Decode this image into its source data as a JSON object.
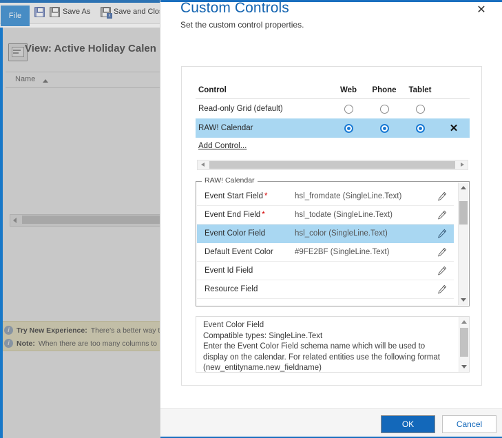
{
  "background_app": {
    "file_tab": "File",
    "ribbon_buttons": [
      {
        "label": "",
        "icon": "save-icon"
      },
      {
        "label": "Save As",
        "icon": "save-as-icon"
      },
      {
        "label": "Save and Clos",
        "icon": "save-and-close-icon"
      }
    ],
    "view_title": "View: Active Holiday Calen",
    "grid_column_header": "Name",
    "sort_direction": "ascending",
    "notices": [
      {
        "title": "Try New Experience:",
        "text": "There's a better way t"
      },
      {
        "title": "Note:",
        "text": "When there are too many columns to"
      }
    ]
  },
  "dialog": {
    "title": "Custom Controls",
    "subtitle": "Set the custom control properties.",
    "close_label": "✕",
    "controls_table": {
      "headers": [
        "Control",
        "Web",
        "Phone",
        "Tablet"
      ],
      "rows": [
        {
          "name": "Read-only Grid (default)",
          "web": false,
          "phone": false,
          "tablet": false,
          "selected": false,
          "deletable": false
        },
        {
          "name": "RAW! Calendar",
          "web": true,
          "phone": true,
          "tablet": true,
          "selected": true,
          "deletable": true,
          "delete_label": "✕"
        }
      ]
    },
    "add_control_label": "Add Control...",
    "properties": {
      "group_label": "RAW! Calendar",
      "rows": [
        {
          "label": "Event Start Field",
          "required": true,
          "value": "hsl_fromdate (SingleLine.Text)",
          "selected": false
        },
        {
          "label": "Event End Field",
          "required": true,
          "value": "hsl_todate (SingleLine.Text)",
          "selected": false
        },
        {
          "label": "Event Color Field",
          "required": false,
          "value": "hsl_color (SingleLine.Text)",
          "selected": true
        },
        {
          "label": "Default Event Color",
          "required": false,
          "value": "#9FE2BF (SingleLine.Text)",
          "selected": false
        },
        {
          "label": "Event Id Field",
          "required": false,
          "value": "",
          "selected": false
        },
        {
          "label": "Resource Field",
          "required": false,
          "value": "",
          "selected": false
        }
      ]
    },
    "description": "Event Color Field\nCompatible types: SingleLine.Text\nEnter the Event Color Field schema name which will be used to display on the calendar. For related entities use the following format (new_entityname.new_fieldname)",
    "footer": {
      "ok_label": "OK",
      "cancel_label": "Cancel"
    }
  },
  "colors": {
    "accent": "#1368ba",
    "title_blue": "#1263b0",
    "selection_blue": "#a9d7f2",
    "radio_blue": "#1a7ad4",
    "required_red": "#d40000",
    "notice_yellow": "#f5eec7",
    "default_event_color": "#9FE2BF"
  }
}
